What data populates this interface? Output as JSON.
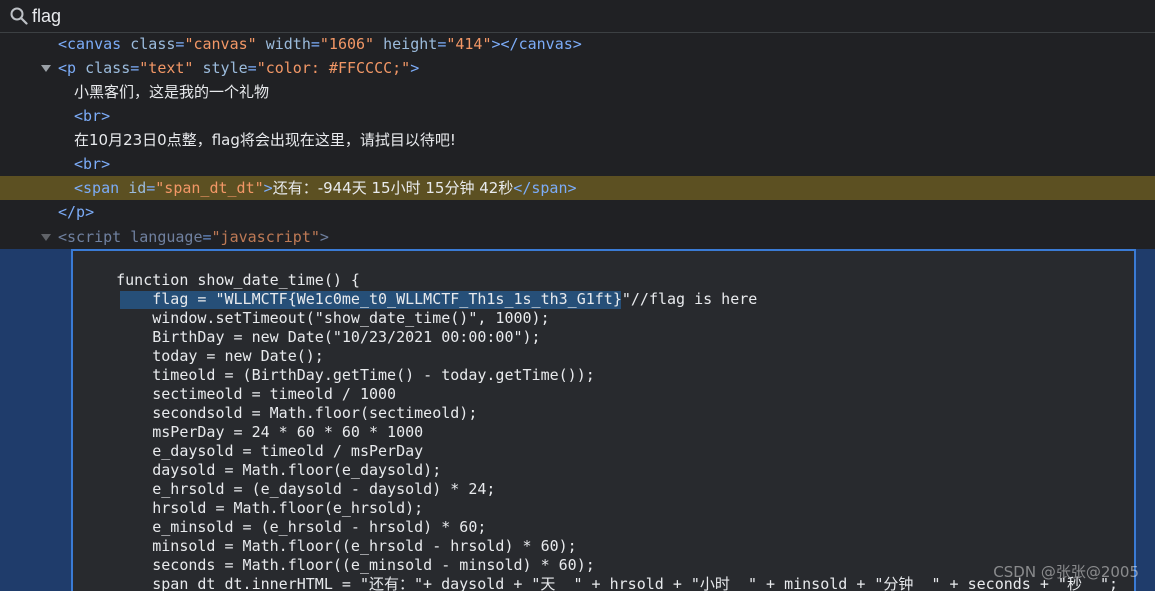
{
  "search": {
    "value": "flag"
  },
  "elements": {
    "canvas": {
      "open": "<canvas",
      "attr1": "class",
      "val1": "\"canvas\"",
      "attr2": "width",
      "val2": "\"1606\"",
      "attr3": "height",
      "val3": "\"414\"",
      "close": "></canvas>"
    },
    "p": {
      "open": "<p",
      "attr1": "class",
      "val1": "\"text\"",
      "attr2": "style",
      "val2": "\"color: #FFCCCC;\"",
      "close": ">"
    },
    "text1": "小黑客们，这是我的一个礼物",
    "br": "<br>",
    "text2": "在10月23日0点整，flag将会出现在这里，请拭目以待吧!",
    "span": {
      "open": "<span",
      "attr": "id",
      "val": "\"span_dt_dt\"",
      "close": ">",
      "content": "还有：-944天 15小时 15分钟 42秒",
      "end": "</span>"
    },
    "p_end": "</p>",
    "script": {
      "open": "<script",
      "attr": "language",
      "val": "\"javascript\"",
      "close": ">"
    }
  },
  "code": {
    "lines": [
      "    function show_date_time() {",
      "        flag = \"WLLMCTF{We1c0me_t0_WLLMCTF_Th1s_1s_th3_G1ft}\"//flag is here",
      "        window.setTimeout(\"show_date_time()\", 1000);",
      "        BirthDay = new Date(\"10/23/2021 00:00:00\");",
      "        today = new Date();",
      "        timeold = (BirthDay.getTime() - today.getTime());",
      "        sectimeold = timeold / 1000",
      "        secondsold = Math.floor(sectimeold);",
      "        msPerDay = 24 * 60 * 60 * 1000",
      "        e_daysold = timeold / msPerDay",
      "        daysold = Math.floor(e_daysold);",
      "        e_hrsold = (e_daysold - daysold) * 24;",
      "        hrsold = Math.floor(e_hrsold);",
      "        e_minsold = (e_hrsold - hrsold) * 60;",
      "        minsold = Math.floor((e_hrsold - hrsold) * 60);",
      "        seconds = Math.floor((e_minsold - minsold) * 60);",
      "        span_dt_dt.innerHTML = \"还有：\"+ daysold + \"天  \" + hrsold + \"小时  \" + minsold + \"分钟  \" + seconds + \"秒  \";"
    ]
  },
  "watermark": "CSDN @张张@2005",
  "colors": {
    "background": "#202124",
    "tag": "#7cacf8",
    "attribute_value": "#f29766",
    "highlight_row": "#5c5022",
    "selection": "#264f78",
    "editor_border": "#3a7bd5"
  }
}
